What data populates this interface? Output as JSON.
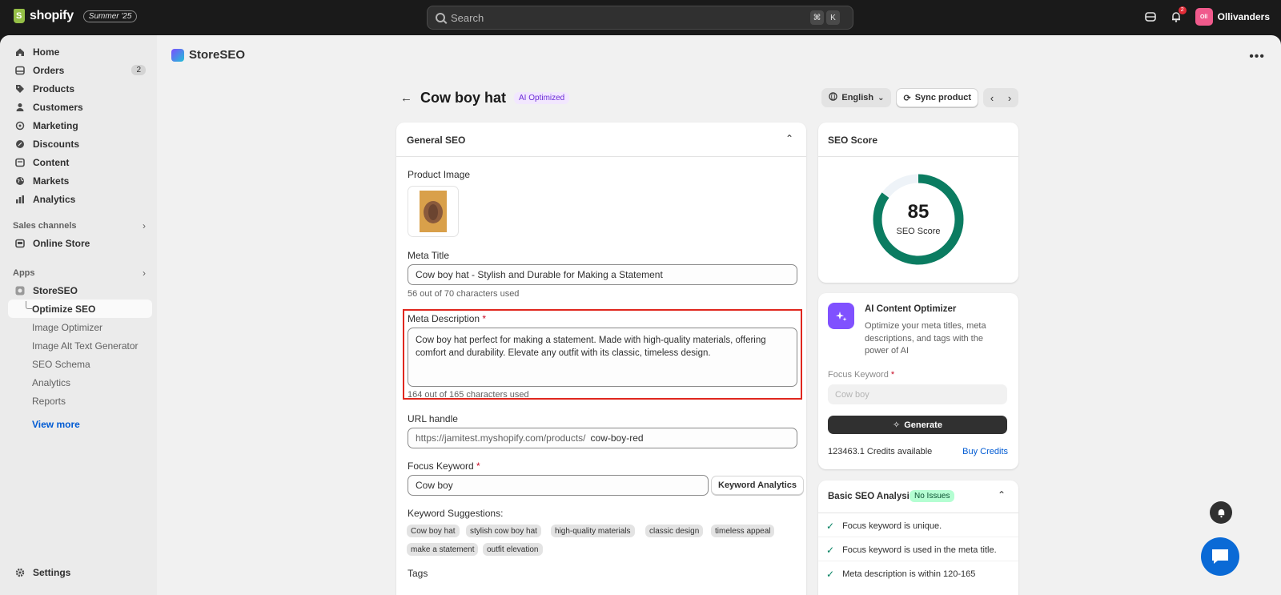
{
  "topbar": {
    "brand": "shopify",
    "edition": "Summer '25",
    "search_placeholder": "Search",
    "kbd1": "⌘",
    "kbd2": "K",
    "notif_count": "2",
    "store_initials": "Oll",
    "store_name": "Ollivanders"
  },
  "sidebar": {
    "items": [
      {
        "label": "Home",
        "icon": "home-icon"
      },
      {
        "label": "Orders",
        "icon": "orders-icon",
        "count": "2"
      },
      {
        "label": "Products",
        "icon": "tag-icon"
      },
      {
        "label": "Customers",
        "icon": "person-icon"
      },
      {
        "label": "Marketing",
        "icon": "target-icon"
      },
      {
        "label": "Discounts",
        "icon": "discount-icon"
      },
      {
        "label": "Content",
        "icon": "content-icon"
      },
      {
        "label": "Markets",
        "icon": "globe-icon"
      },
      {
        "label": "Analytics",
        "icon": "bar-chart-icon"
      }
    ],
    "sales_channels_label": "Sales channels",
    "online_store": "Online Store",
    "apps_label": "Apps",
    "app_name": "StoreSEO",
    "sub_items": [
      "Optimize SEO",
      "Image Optimizer",
      "Image Alt Text Generator",
      "SEO Schema",
      "Analytics",
      "Reports"
    ],
    "view_more": "View more",
    "settings": "Settings"
  },
  "app": {
    "name": "StoreSEO"
  },
  "page": {
    "title": "Cow boy hat",
    "badge": "AI Optimized",
    "language": "English",
    "sync": "Sync product"
  },
  "general_seo": {
    "title": "General SEO",
    "product_image_label": "Product Image",
    "meta_title_label": "Meta Title",
    "meta_title_value": "Cow boy hat - Stylish and Durable for Making a Statement",
    "meta_title_helper": "56 out of 70 characters used",
    "meta_desc_label": "Meta Description",
    "required_mark": "*",
    "meta_desc_line1": "Cow boy hat perfect for making a statement. Made with high-quality materials, offering",
    "meta_desc_line2": "comfort and durability. Elevate any outfit with its classic, timeless design.",
    "meta_desc_helper": "164 out of 165 characters used",
    "url_label": "URL handle",
    "url_prefix": "https://jamitest.myshopify.com/products/",
    "url_value": "cow-boy-red",
    "focus_label": "Focus Keyword",
    "focus_value": "Cow boy",
    "keyword_analytics": "Keyword Analytics",
    "suggestions_label": "Keyword Suggestions:",
    "suggestions": [
      "Cow boy hat",
      "stylish cow boy hat",
      "high-quality materials",
      "classic design",
      "timeless appeal",
      "make a statement",
      "outfit elevation"
    ],
    "tags_label": "Tags"
  },
  "seo_score": {
    "title": "SEO Score",
    "value": "85",
    "percent": 85,
    "label": "SEO Score"
  },
  "ai_optimizer": {
    "title": "AI Content Optimizer",
    "desc_line1": "Optimize your meta titles, meta",
    "desc_line2": "descriptions, and tags with the",
    "desc_line3": "power of AI",
    "focus_label": "Focus Keyword",
    "focus_placeholder": "Cow boy",
    "generate": "Generate",
    "credits": "123463.1 Credits available",
    "buy": "Buy Credits"
  },
  "basic_analysis": {
    "title": "Basic SEO Analysis",
    "badge": "No Issues",
    "checks": [
      "Focus keyword is unique.",
      "Focus keyword is used in the meta title.",
      "Meta description is within 120-165"
    ]
  },
  "colors": {
    "gauge": "#0b7c61",
    "highlight": "#e0271e",
    "accent": "#005bd3"
  }
}
